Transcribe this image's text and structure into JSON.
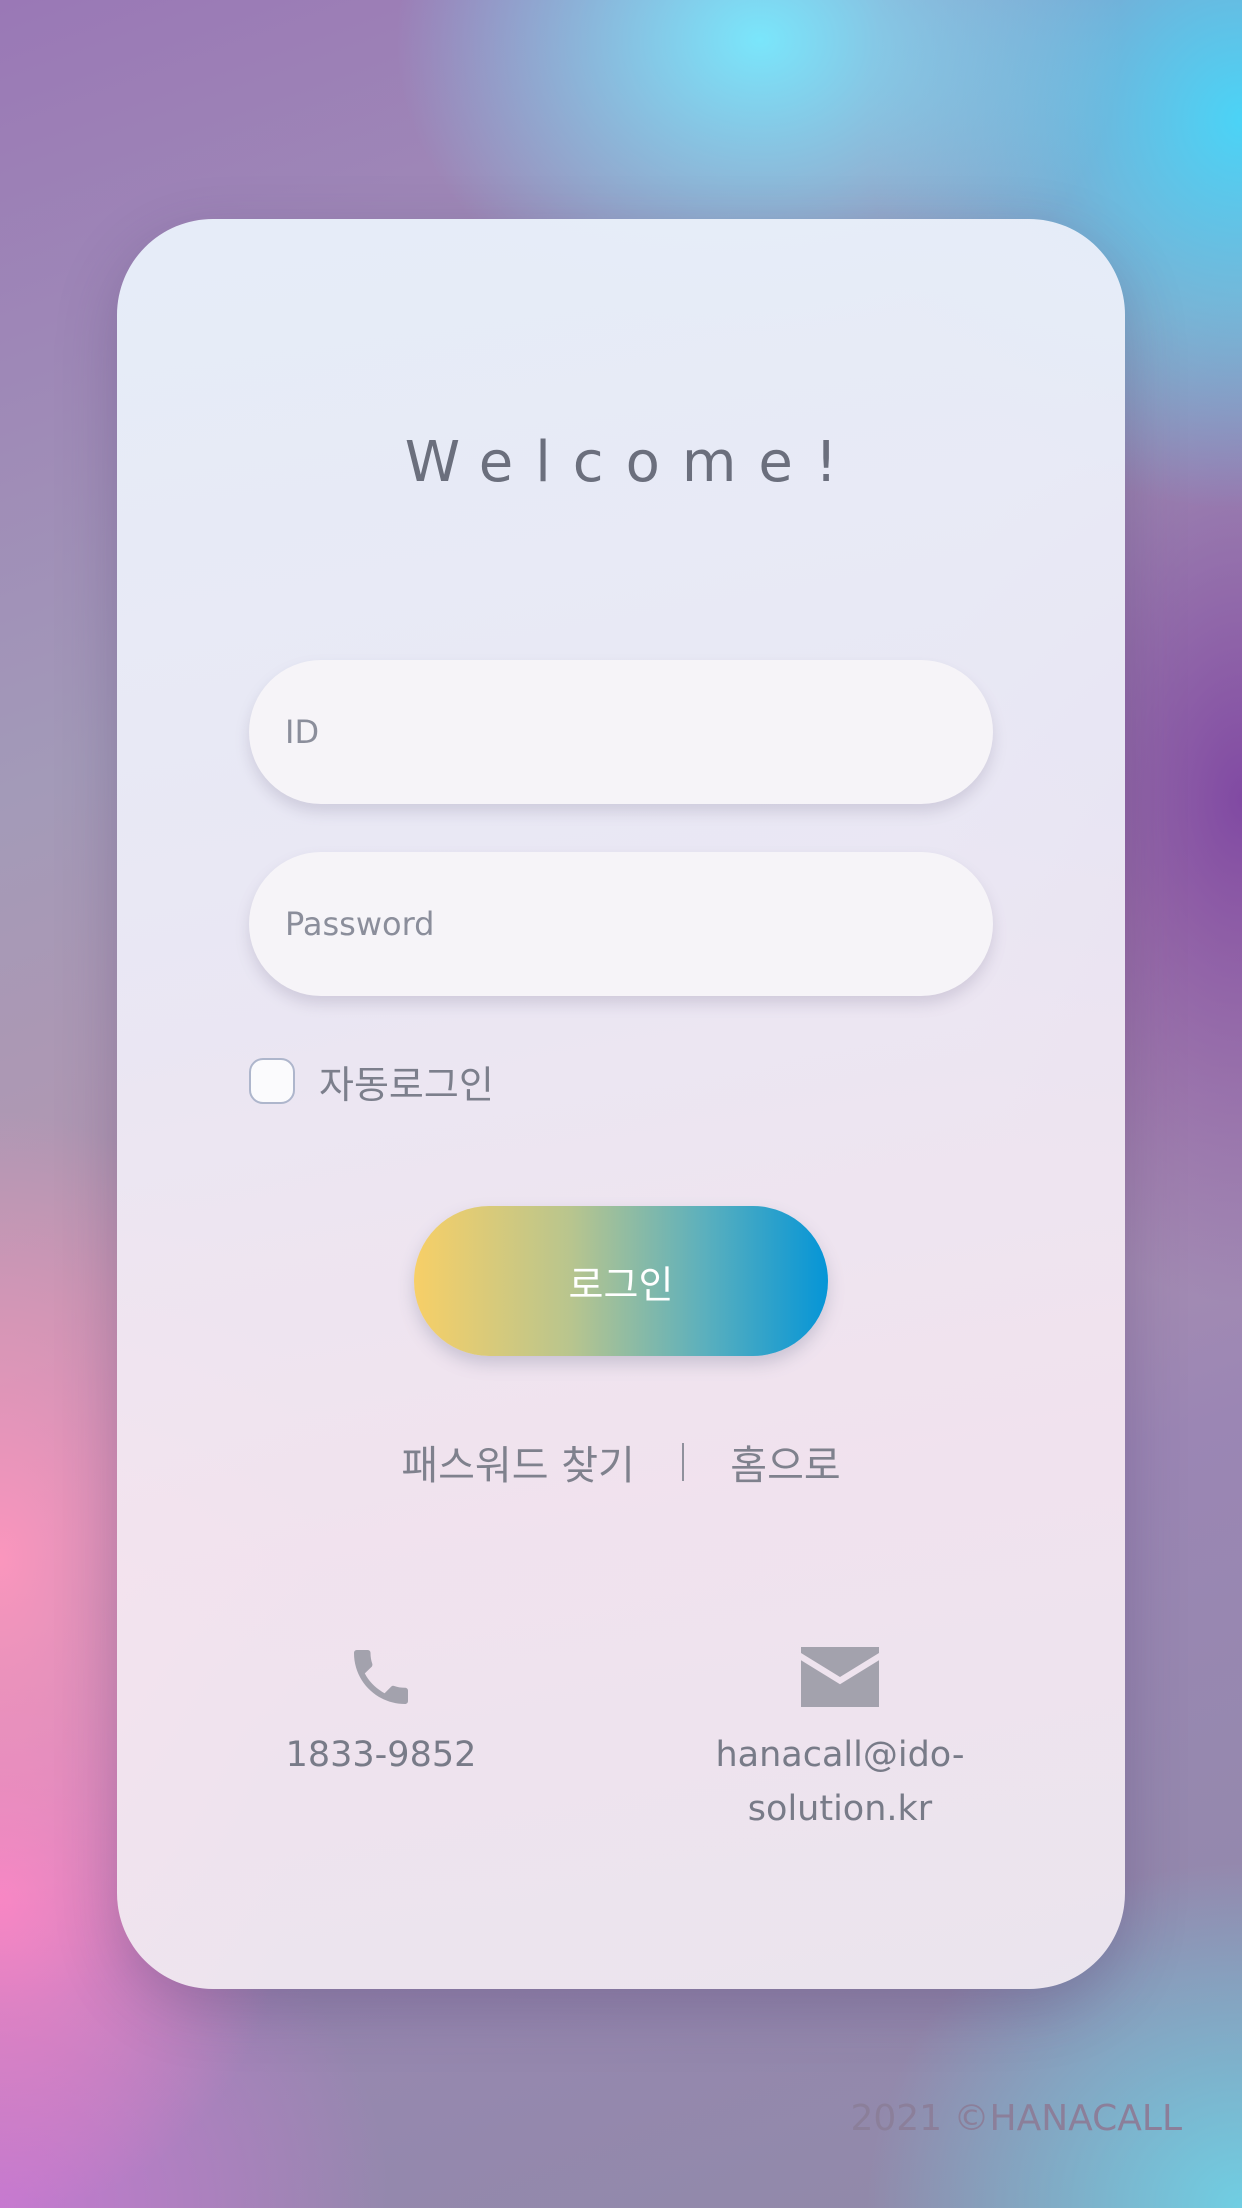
{
  "welcome": {
    "title": "Welcome!"
  },
  "form": {
    "id_placeholder": "ID",
    "password_placeholder": "Password",
    "auto_login_label": "자동로그인",
    "login_button": "로그인"
  },
  "links": {
    "find_password": "패스워드 찾기",
    "home": "홈으로"
  },
  "contact": {
    "phone": "1833-9852",
    "email_line1": "hanacall@ido-",
    "email_line2": "solution.kr",
    "phone_icon": "phone-icon",
    "mail_icon": "mail-icon"
  },
  "footer": {
    "copyright": "2021 ©HANACALL"
  },
  "colors": {
    "button_gradient_start": "#f7cf67",
    "button_gradient_end": "#0595d7",
    "text_muted": "#7c7f8c"
  }
}
